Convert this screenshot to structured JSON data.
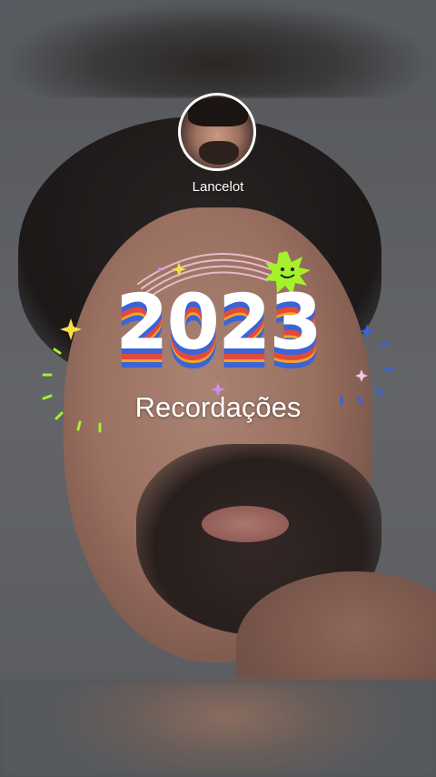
{
  "profile": {
    "name": "Lancelot"
  },
  "recap": {
    "year": "2023",
    "subtitle": "Recordações"
  },
  "colors": {
    "blue": "#3a64d8",
    "red": "#e24a3c",
    "yellow": "#f5a524",
    "green": "#a4f22c",
    "text": "#ffffff"
  },
  "icons": [
    "sparkle-icon",
    "smiley-starburst-icon",
    "rainbow-arc-icon"
  ]
}
